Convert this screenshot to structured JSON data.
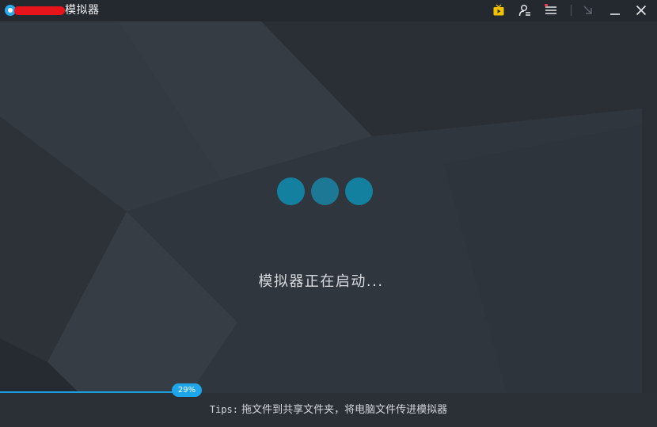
{
  "window": {
    "title": "模拟器",
    "controls": {
      "tv_icon": "tv-icon",
      "account_icon": "user-key-icon",
      "menu_icon": "menu-icon",
      "collapse_icon": "arrow-down-right-icon",
      "minimize_icon": "minimize-icon",
      "close_icon": "close-icon"
    },
    "menu_has_notification": true
  },
  "loading": {
    "status": "模拟器正在启动...",
    "dot_colors": [
      "#14809f",
      "#1c7894",
      "#14809f"
    ]
  },
  "progress": {
    "percent": 29,
    "label": "29%",
    "color": "#1a9fe0"
  },
  "footer": {
    "tips_prefix": "Tips:",
    "tips_text": " 拖文件到共享文件夹，将电脑文件传进模拟器"
  },
  "colors": {
    "accent": "#1fa6ea",
    "notification": "#e8404a",
    "tv_icon": "#f2c200"
  }
}
